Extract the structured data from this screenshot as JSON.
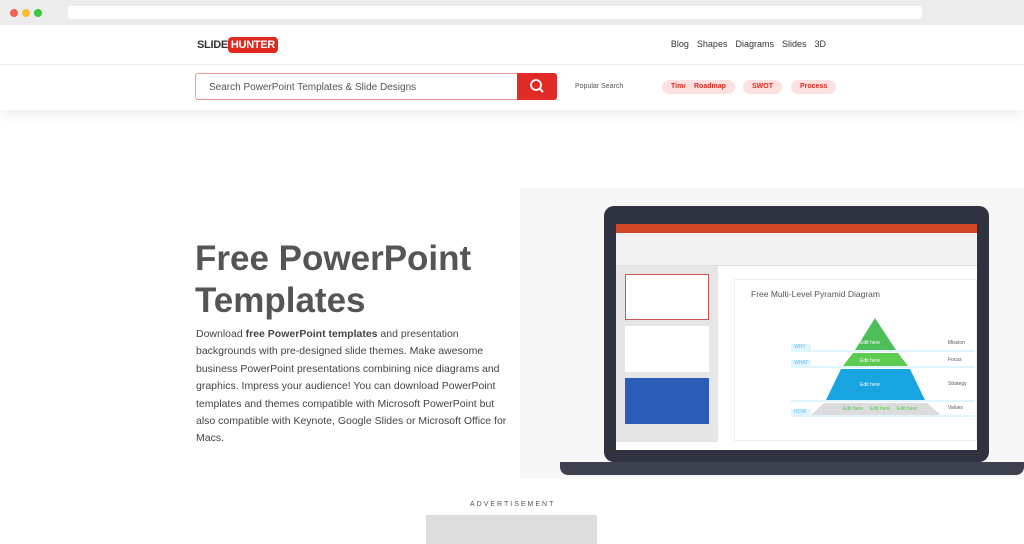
{
  "logo": {
    "part1": "SLIDE",
    "part2": "HUNTER"
  },
  "nav": [
    "Blog",
    "Shapes",
    "Diagrams",
    "Slides",
    "3D"
  ],
  "search": {
    "placeholder": "Search PowerPoint Templates & Slide Designs",
    "icon": "search-icon"
  },
  "popular": {
    "label": "Popular Search",
    "tags": [
      "Timeline",
      "Roadmap",
      "SWOT",
      "Process"
    ]
  },
  "hero": {
    "title": "Free PowerPoint Templates",
    "paragraph_before": "Download ",
    "paragraph_bold": "free PowerPoint templates",
    "paragraph_after": " and presentation backgrounds with pre-designed slide themes. Make awesome business PowerPoint presentations combining nice diagrams and graphics. Impress your audience! You can download PowerPoint templates and themes compatible with Microsoft PowerPoint but also compatible with Keynote, Google Slides or Microsoft Office for Macs."
  },
  "slide": {
    "title": "Free Multi-Level Pyramid Diagram",
    "edit": "Edit here",
    "labels": [
      "Mission",
      "Focus",
      "Strategy",
      "Values"
    ],
    "left": [
      "WHY",
      "WHAT",
      "HOW"
    ]
  },
  "ad": {
    "label": "ADVERTISEMENT"
  },
  "colors": {
    "accent": "#e0281f",
    "green": "#5cc95a",
    "blue": "#1aa3e0"
  }
}
